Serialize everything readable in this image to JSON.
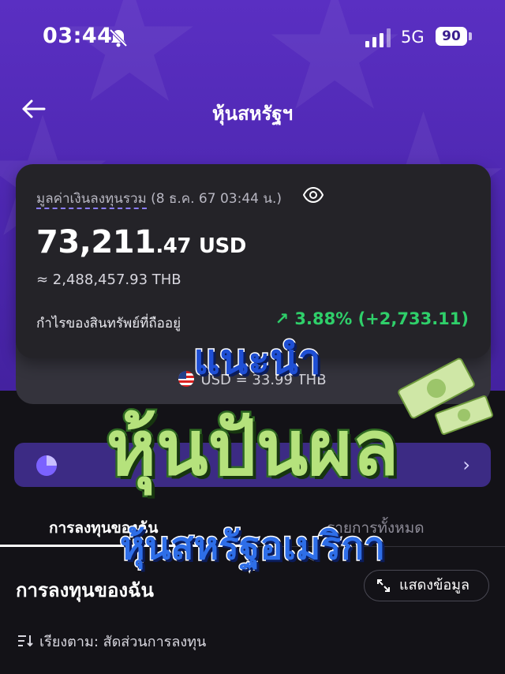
{
  "status_bar": {
    "time": "03:44",
    "network": "5G",
    "battery": "90"
  },
  "nav": {
    "title": "หุ้นสหรัฐฯ"
  },
  "portfolio": {
    "value_label": "มูลค่าเงินลงทุนรวม",
    "timestamp": "(8 ธ.ค. 67 03:44 น.)",
    "amount_int": "73,211",
    "amount_dec": ".47",
    "currency": "USD",
    "approx_thb": "≈ 2,488,457.93 THB",
    "profit_label": "กำไรของสินทรัพย์ที่ถืออยู่",
    "profit_value": "↗ 3.88% (+2,733.11)",
    "profit_color": "#2fcf6a"
  },
  "exchange": {
    "rate_text": "USD = 33.99 THB"
  },
  "promo": {
    "text": "ปันผล"
  },
  "tabs": [
    {
      "label": "การลงทุนของฉัน"
    },
    {
      "label": "รายการทั้งหมด"
    }
  ],
  "section": {
    "title": "การลงทุนของฉัน",
    "show_button": "แสดงข้อมูล"
  },
  "sort": {
    "label": "เรียงตาม: สัดส่วนการลงทุน"
  },
  "overlay": {
    "line1": "แนะนำ",
    "line2": "หุ้นปันผล",
    "line3": "หุ้นสหรัฐอเมริกา"
  },
  "colors": {
    "accent": "#5a2fc2",
    "card": "#242328",
    "positive": "#2fcf6a"
  },
  "icons": [
    "mute-icon",
    "signal-icon",
    "back-arrow-icon",
    "eye-icon",
    "us-flag-icon",
    "pie-chart-icon",
    "chevron-right-icon",
    "expand-icon",
    "sort-icon"
  ]
}
